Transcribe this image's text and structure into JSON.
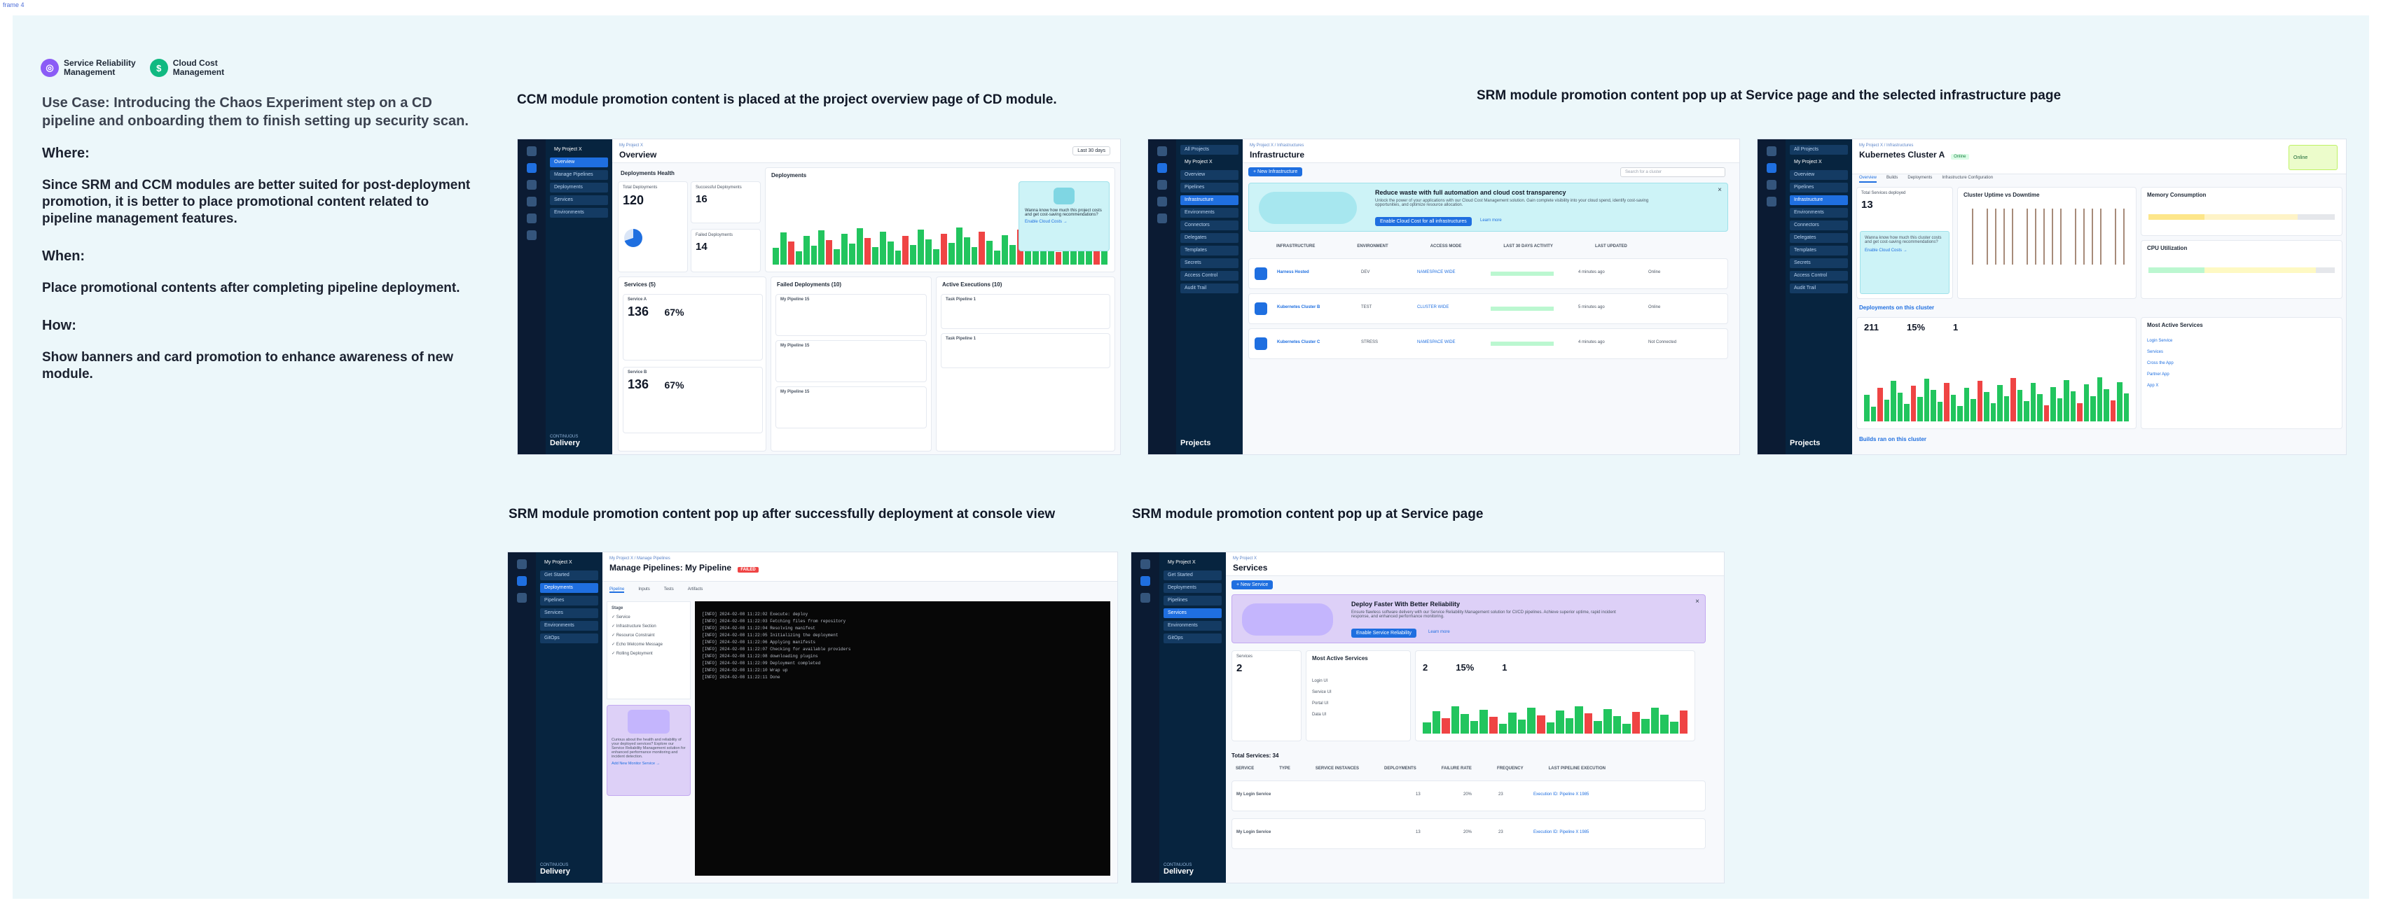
{
  "frame_tag": "frame 4",
  "logos": [
    {
      "name": "Service Reliability\nManagement",
      "color": "#8b5cf6",
      "glyph": "◎"
    },
    {
      "name": "Cloud Cost\nManagement",
      "color": "#10b981",
      "glyph": "$"
    }
  ],
  "left": {
    "use_case": "Use Case: Introducing the Chaos Experiment step on a CD pipeline and onboarding them to finish setting up security scan.",
    "where_h": "Where:",
    "where_b": "Since SRM and CCM modules are better suited for post-deployment promotion, it is better to place promotional content related to pipeline management features.",
    "when_h": "When:",
    "when_b": "Place promotional contents after completing pipeline deployment.",
    "how_h": "How:",
    "how_b": "Show banners and card promotion to enhance awareness of new module."
  },
  "captions": {
    "c1": "CCM module promotion content is placed at the project overview page of CD module.",
    "c2": "SRM module promotion content pop up at Service page and the selected infrastructure page",
    "c3": "SRM module promotion content pop up after successfully deployment at console view",
    "c4": "SRM module promotion content pop up at Service page"
  },
  "shot1": {
    "crumb": "My Project X",
    "title": "Overview",
    "range": "Last 30 days",
    "health": "Deployments Health",
    "total_label": "Total Deployments",
    "total": "120",
    "success_label": "Successful Deployments",
    "success": "16",
    "failed_label": "Failed Deployments",
    "failed": "14",
    "deployments": "Deployments",
    "services": "Services (5)",
    "failed_dep": "Failed Deployments (10)",
    "active_exec": "Active Executions (10)",
    "svc_a": "Service A",
    "svc_b": "Service B",
    "svc_num": "136",
    "svc_pct": "67%",
    "pipeline": "My Pipeline 15",
    "task": "Task Pipeline 1",
    "promo": "Wanna know how much this project costs and get cost-saving recommendations?",
    "promo_link": "Enable Cloud Costs →",
    "project": "My Project X",
    "menu": [
      "Overview",
      "Manage Pipelines",
      "Deployments",
      "Services",
      "Environments"
    ],
    "footer": "Delivery",
    "footer_small": "CONTINUOUS"
  },
  "shot2": {
    "crumb": "My Project X / Infrastructures",
    "title": "Infrastructure",
    "new_btn": "+ New Infrastructure",
    "search": "Search for a cluster",
    "promo_title": "Reduce waste with full automation and cloud cost transparency",
    "promo_body": "Unlock the power of your applications with our Cloud Cost Management solution. Gain complete visibility into your cloud spend, identify cost-saving opportunities, and optimize resource allocation.",
    "promo_btn": "Enable Cloud Cost for all infrastructures",
    "promo_link": "Learn more",
    "cols": [
      "INFRASTRUCTURE",
      "ENVIRONMENT",
      "ACCESS MODE",
      "LAST 30 DAYS ACTIVITY",
      "LAST UPDATED"
    ],
    "rows": [
      {
        "name": "Harness Hosted",
        "env": "DEV",
        "access": "NAMESPACE WIDE",
        "updated": "4 minutes ago",
        "status": "Online"
      },
      {
        "name": "Kubernetes Cluster B",
        "env": "TEST",
        "access": "CLUSTER WIDE",
        "updated": "5 minutes ago",
        "status": "Online"
      },
      {
        "name": "Kubernetes Cluster C",
        "env": "STRESS",
        "access": "NAMESPACE WIDE",
        "updated": "4 minutes ago",
        "status": "Not Connected"
      }
    ],
    "menu": [
      "All Projects",
      "My Project X",
      "Overview",
      "Pipelines",
      "Infrastructure",
      "Environments",
      "Connectors",
      "Delegates",
      "Templates",
      "Secrets",
      "Access Control",
      "Audit Trail"
    ],
    "footer": "Projects"
  },
  "shot3": {
    "crumb": "My Project X / Infrastructures",
    "title": "Kubernetes Cluster A",
    "badge": "Online",
    "tabs": [
      "Overview",
      "Builds",
      "Deployments",
      "Infrastructure Configuration"
    ],
    "connectivity": "Online",
    "total_services": "Total Services deployed",
    "total_services_val": "13",
    "uptime": "Cluster Uptime vs Downtime",
    "memory": "Memory Consumption",
    "cpu": "CPU Utilization",
    "promo": "Wanna know how much this cluster costs and get cost-saving recommendations?",
    "promo_link": "Enable Cloud Costs →",
    "deploy_title": "Deployments on this cluster",
    "deployments_val": "211",
    "failure_rate": "15%",
    "freq": "1",
    "most_active": "Most Active Services",
    "builds": "Builds ran on this cluster",
    "services": [
      "Login Service",
      "Services",
      "Cross the App",
      "Partner App",
      "App X"
    ],
    "menu": [
      "All Projects",
      "My Project X",
      "Overview",
      "Pipelines",
      "Infrastructure",
      "Environments",
      "Connectors",
      "Delegates",
      "Templates",
      "Secrets",
      "Access Control",
      "Audit Trail"
    ],
    "footer": "Projects"
  },
  "shot4": {
    "crumb": "My Project X / Manage Pipelines",
    "title": "Manage Pipelines: My Pipeline",
    "tag": "FAILED",
    "tabs": [
      "Pipeline",
      "Inputs",
      "Tests",
      "Artifacts"
    ],
    "stage": "Stage",
    "steps": [
      "Service",
      "Infrastructure Section",
      "Resource Constraint",
      "Echo Welcome Message",
      "Rolling Deployment"
    ],
    "promo": "Curious about the health and reliability of your deployed services? Explore our Service Reliability Management solution for enhanced performance monitoring and incident detection.",
    "promo_link": "Add New Monitor Service →",
    "console": [
      "[INFO] 2024-02-08 11:22:02  Execute: deploy",
      "[INFO] 2024-02-08 11:22:03  Fetching files from repository",
      "[INFO] 2024-02-08 11:22:04  Resolving manifest",
      "[INFO] 2024-02-08 11:22:05  Initializing the deployment",
      "[INFO] 2024-02-08 11:22:06  Applying manifests",
      "[INFO] 2024-02-08 11:22:07  Checking for available providers",
      "[INFO] 2024-02-08 11:22:08  downloading plugins",
      "[INFO] 2024-02-08 11:22:09  Deployment completed",
      "[INFO] 2024-02-08 11:22:10  Wrap up",
      "[INFO] 2024-02-08 11:22:11  Done"
    ],
    "menu": [
      "Get Started",
      "Deployments",
      "Pipelines",
      "Services",
      "Environments",
      "GitOps"
    ],
    "project": "My Project X",
    "footer": "Delivery",
    "footer_small": "CONTINUOUS"
  },
  "shot5": {
    "crumb": "My Project X",
    "title": "Services",
    "new_btn": "+ New Service",
    "promo_title": "Deploy Faster With Better Reliability",
    "promo_body": "Ensure flawless software delivery with our Service Reliability Management solution for CI/CD pipelines. Achieve superior uptime, rapid incident response, and enhanced performance monitoring.",
    "promo_btn": "Enable Service Reliability",
    "promo_link": "Learn more",
    "services_label": "Services",
    "services_val": "2",
    "most_active": "Most Active Services",
    "deployments": "Deployments",
    "deployments_val": "2",
    "failure_rate": "15%",
    "freq": "1",
    "list": [
      "Login UI",
      "Service UI",
      "Portal UI",
      "Data UI"
    ],
    "total": "Total Services: 34",
    "cols": [
      "SERVICE",
      "TYPE",
      "SERVICE INSTANCES",
      "DEPLOYMENTS",
      "FAILURE RATE",
      "FREQUENCY",
      "LAST PIPELINE EXECUTION"
    ],
    "rows": [
      {
        "name": "My Login Service",
        "deps": "13",
        "fail": "20%",
        "freq": "23",
        "exec": "Execution ID: Pipeline X 1985"
      },
      {
        "name": "My Login Service",
        "deps": "13",
        "fail": "20%",
        "freq": "23",
        "exec": "Execution ID: Pipeline X 1985"
      }
    ],
    "menu": [
      "Get Started",
      "Deployments",
      "Pipelines",
      "Services",
      "Environments",
      "GitOps"
    ],
    "project": "My Project X",
    "footer": "Delivery",
    "footer_small": "CONTINUOUS"
  }
}
